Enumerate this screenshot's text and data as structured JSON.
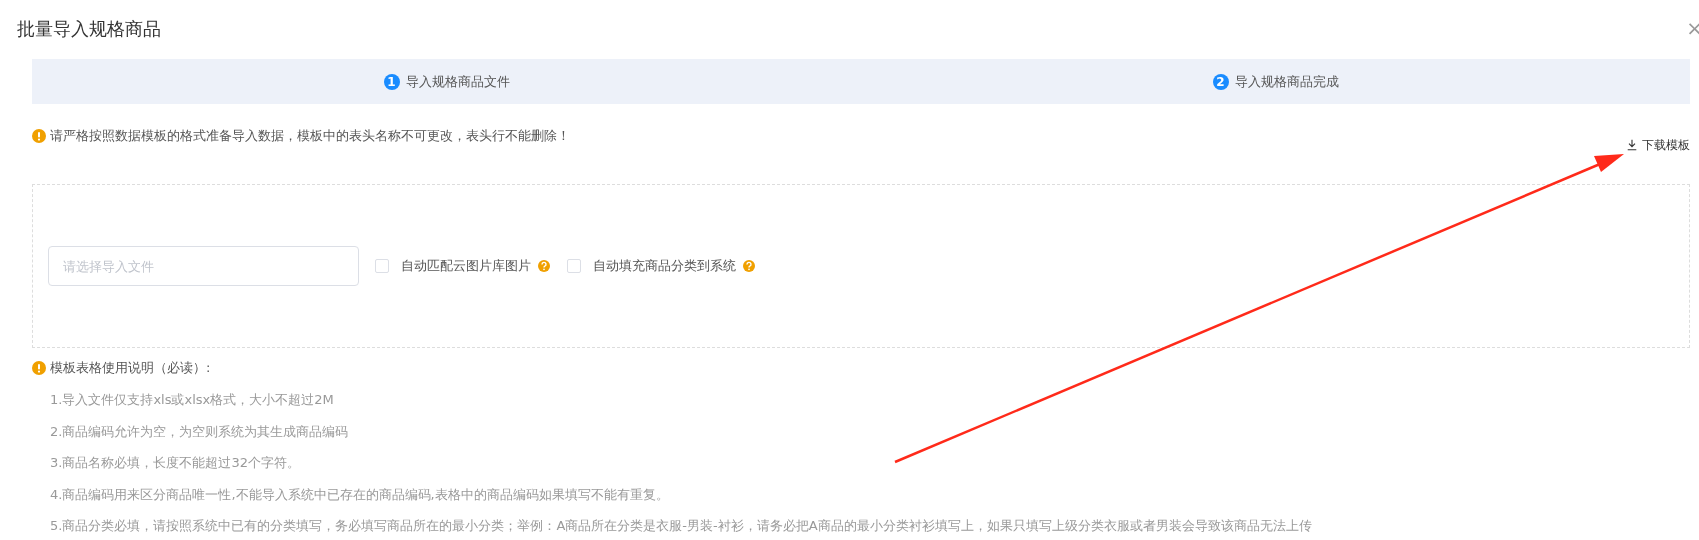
{
  "dialog": {
    "title": "批量导入规格商品",
    "close": "×"
  },
  "steps": [
    {
      "number": "1",
      "label": "导入规格商品文件"
    },
    {
      "number": "2",
      "label": "导入规格商品完成"
    }
  ],
  "notice": "请严格按照数据模板的格式准备导入数据，模板中的表头名称不可更改，表头行不能删除！",
  "download": "下载模板",
  "file_field": {
    "placeholder": "请选择导入文件"
  },
  "options": [
    {
      "label": "自动匹配云图片库图片",
      "checked": false
    },
    {
      "label": "自动填充商品分类到系统",
      "checked": false
    }
  ],
  "instructions": {
    "heading": "模板表格使用说明（必读）:",
    "items": [
      "1.导入文件仅支持xls或xlsx格式，大小不超过2M",
      "2.商品编码允许为空，为空则系统为其生成商品编码",
      "3.商品名称必填，长度不能超过32个字符。",
      "4.商品编码用来区分商品唯一性,不能导入系统中已存在的商品编码,表格中的商品编码如果填写不能有重复。",
      "5.商品分类必填，请按照系统中已有的分类填写，务必填写商品所在的最小分类；举例：A商品所在分类是衣服-男装-衬衫，请务必把A商品的最小分类衬衫填写上，如果只填写上级分类衣服或者男装会导致该商品无法上传"
    ]
  }
}
